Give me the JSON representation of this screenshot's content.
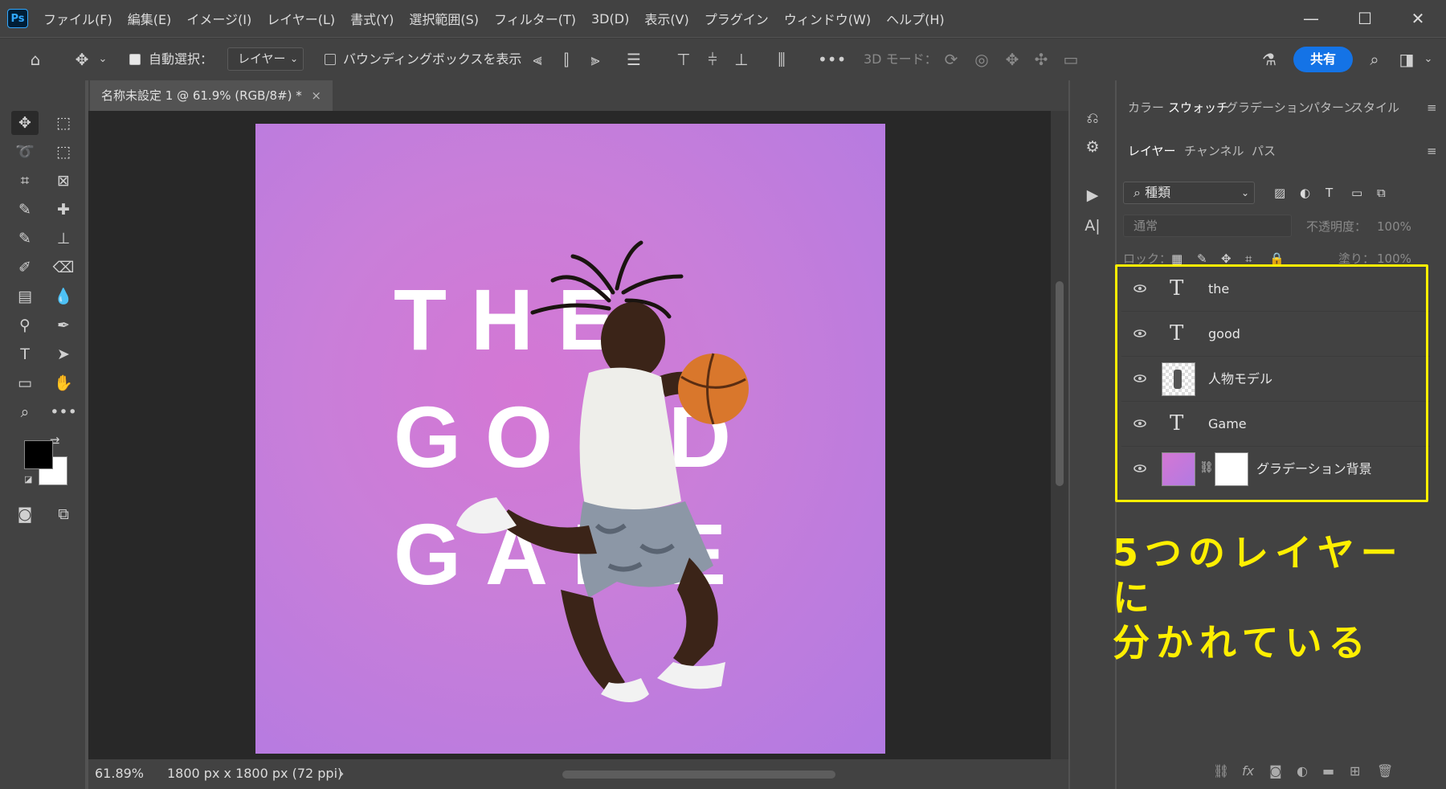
{
  "app": {
    "logo": "Ps"
  },
  "menu": [
    "ファイル(F)",
    "編集(E)",
    "イメージ(I)",
    "レイヤー(L)",
    "書式(Y)",
    "選択範囲(S)",
    "フィルター(T)",
    "3D(D)",
    "表示(V)",
    "プラグイン",
    "ウィンドウ(W)",
    "ヘルプ(H)"
  ],
  "window": {
    "minimize": "—",
    "maximize": "☐",
    "close": "✕"
  },
  "options": {
    "auto_select_label": "自動選択：",
    "auto_select_checked": true,
    "auto_select_target": "レイヤー",
    "bbox_label": "バウンディングボックスを表示",
    "bbox_checked": false,
    "mode3d_label": "3D モード：",
    "share_label": "共有"
  },
  "document": {
    "tab_title": "名称未設定 1 @ 61.9% (RGB/8#) *",
    "close": "×",
    "zoom": "61.89%",
    "dimensions": "1800 px x 1800 px (72 ppi)",
    "words": [
      "THE",
      "GOOD",
      "GAME"
    ]
  },
  "panels": {
    "top_tabs": [
      "カラー",
      "スウォッチ",
      "グラデーション",
      "パターン",
      "スタイル"
    ],
    "top_selected": "スウォッチ",
    "layer_tabs": [
      "レイヤー",
      "チャンネル",
      "パス"
    ],
    "layer_selected": "レイヤー",
    "filter_label": "種類",
    "blend_mode": "通常",
    "opacity_label": "不透明度：",
    "opacity_value": "100%",
    "lock_label": "ロック：",
    "fill_label": "塗り：",
    "fill_value": "100%"
  },
  "layers": [
    {
      "name": "the",
      "kind": "text"
    },
    {
      "name": "good",
      "kind": "text"
    },
    {
      "name": "人物モデル",
      "kind": "smart-object"
    },
    {
      "name": "Game",
      "kind": "text"
    },
    {
      "name": "グラデーション背景",
      "kind": "gradient-masked"
    }
  ],
  "annotation": {
    "line1": "5つのレイヤーに",
    "line2": "分かれている"
  },
  "colors": {
    "highlight": "#ffef00",
    "share": "#1473e6",
    "artboard_top": "#d477d4",
    "artboard_bottom": "#b27ae2"
  }
}
